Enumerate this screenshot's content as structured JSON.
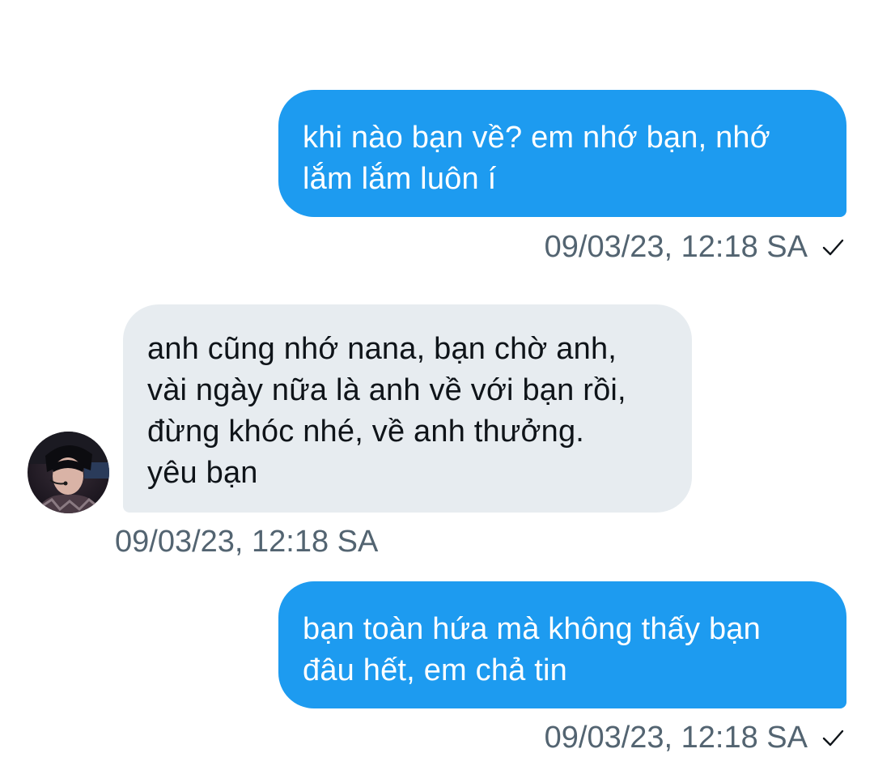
{
  "conversation": {
    "messages": [
      {
        "direction": "sent",
        "text": "khi nào bạn về? em nhớ bạn, nhớ\nlắm lắm luôn í",
        "timestamp": "09/03/23, 12:18 SA",
        "status_icon": "check-icon"
      },
      {
        "direction": "received",
        "text": "anh cũng nhớ nana, bạn chờ anh,\nvài ngày nữa là anh về với bạn rồi,\nđừng khóc nhé, về anh thưởng.\nyêu bạn",
        "timestamp": "09/03/23, 12:18 SA",
        "sender_avatar_icon": "avatar"
      },
      {
        "direction": "sent",
        "text": "bạn toàn hứa mà không thấy bạn\nđâu hết, em chả tin",
        "timestamp": "09/03/23, 12:18 SA",
        "status_icon": "check-icon"
      }
    ]
  },
  "colors": {
    "sent_bubble": "#1d9bf0",
    "received_bubble": "#e7ecf0",
    "timestamp_text": "#536471",
    "background": "#ffffff"
  }
}
